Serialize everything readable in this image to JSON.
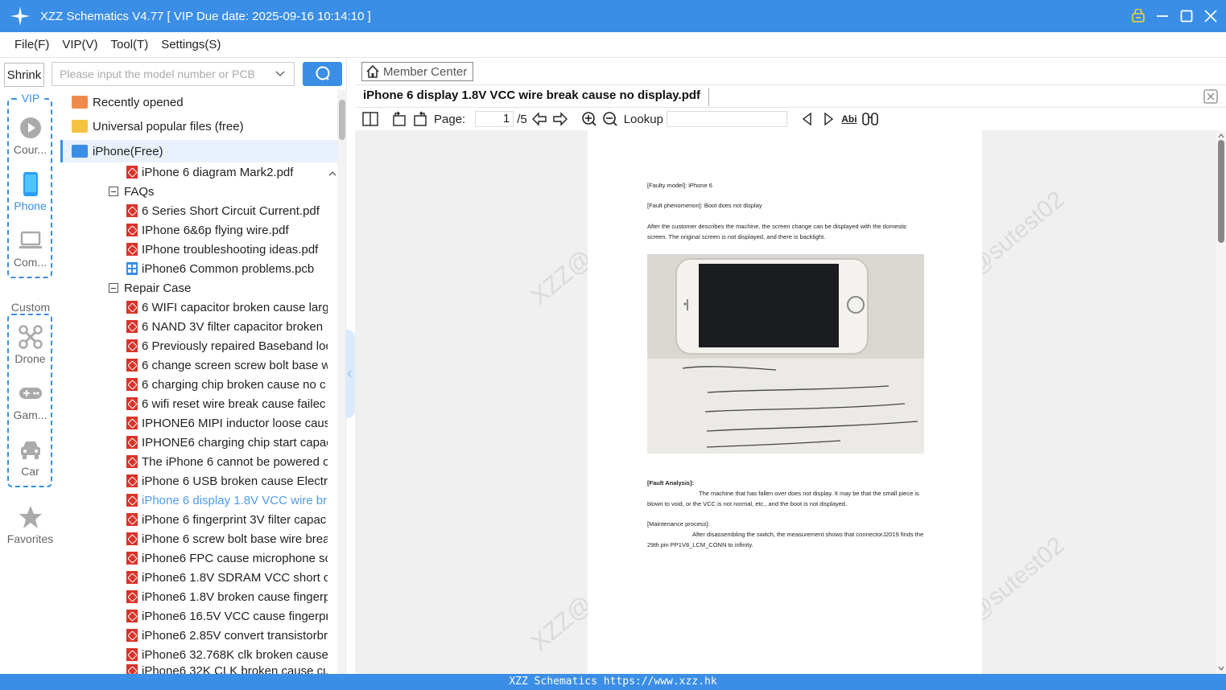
{
  "app": {
    "title": "XZZ Schematics V4.77 [ VIP Due date: 2025-09-16 10:14:10 ]",
    "status_text": "XZZ Schematics https://www.xzz.hk"
  },
  "menu": [
    "File(F)",
    "VIP(V)",
    "Tool(T)",
    "Settings(S)"
  ],
  "leftnav": {
    "shrink_label": "Shrink",
    "vip_label": "VIP",
    "custom_label": "Custom",
    "items": [
      {
        "label": "Cour...",
        "icon": "play-circle-icon"
      },
      {
        "label": "Phone",
        "icon": "phone-icon"
      },
      {
        "label": "Com...",
        "icon": "laptop-icon"
      },
      {
        "label": "Drone",
        "icon": "drone-icon"
      },
      {
        "label": "Gam...",
        "icon": "gamepad-icon"
      },
      {
        "label": "Car",
        "icon": "car-icon"
      },
      {
        "label": "Favorites",
        "icon": "star-icon"
      }
    ]
  },
  "search": {
    "placeholder": "Please input the model number or PCB"
  },
  "tree": {
    "folders": [
      "Recently opened",
      "Universal popular files (free)",
      "iPhone(Free)"
    ],
    "top_file": "iPhone 6 diagram Mark2.pdf",
    "faqs_label": "FAQs",
    "faqs": [
      "6 Series Short Circuit Current.pdf",
      "IPhone 6&6p flying wire.pdf",
      "IPhone troubleshooting ideas.pdf",
      "iPhone6 Common problems.pcb"
    ],
    "repair_label": "Repair Case",
    "repair": [
      "6  WIFI capacitor broken cause larg",
      "6 NAND 3V filter capacitor broken",
      "6 Previously repaired Baseband loc",
      "6 change screen screw bolt base w",
      "6 charging chip broken cause no c",
      "6 wifi reset wire break  cause failec",
      "IPHONE6 MIPI inductor loose caus",
      "IPHONE6 charging chip start capac",
      "The iPhone 6 cannot be powered o",
      "iPhone 6 USB broken cause Electri",
      "iPhone 6 display 1.8V VCC wire bre",
      "iPhone 6 fingerprint 3V filter capac",
      "iPhone 6 screw bolt base wire brea",
      "iPhone6  FPC cause microphone sc",
      "iPhone6 1.8V SDRAM VCC short cir",
      "iPhone6 1.8V broken cause fingerp",
      "iPhone6 16.5V VCC cause fingerpri",
      "iPhone6 2.85V convert transistorbr",
      "iPhone6 32.768K clk broken cause",
      "iPhone6 32K CLK broken cause cu"
    ]
  },
  "viewer": {
    "member_center": "Member Center",
    "tab_title": "iPhone 6 display 1.8V VCC wire break  cause no display.pdf",
    "page_label": "Page:",
    "page_current": "1",
    "page_total": "/5",
    "lookup_label": "Lookup",
    "lookup_value": ""
  },
  "document": {
    "watermark": "XZZ@sutest02",
    "faulty_model": "[Faulty model]: iPhone 6",
    "fault_phenomenon": "[Fault phenomenon]: Boot does not display",
    "description": "After the customer describes the machine, the screen change can be displayed with the domestic screen. The original screen is not displayed, and there is backlight.",
    "fault_analysis_title": "[Fault Analysis]:",
    "fault_analysis": "The machine that has fallen over does not display. It may be that the small piece is blown to void, or the VCC is not normal, etc., and the boot is not displayed.",
    "maintenance_title": "[Maintenance process]:",
    "maintenance": "After disassembling the switch, the measurement shows that connectorJ2019 finds the 29th pin PP1V8_LCM_CONN to infinity."
  },
  "colors": {
    "accent": "#3a8ee6",
    "pdf_icon": "#d9342b",
    "link": "#4f9be8",
    "folder_orange": "#f08a4b",
    "folder_yellow": "#f5c342",
    "folder_blue": "#3a8ee6"
  }
}
